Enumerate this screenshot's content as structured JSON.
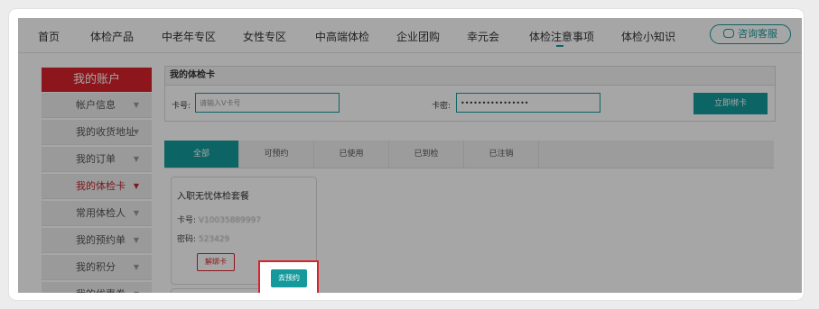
{
  "nav": {
    "items": [
      "首页",
      "体检产品",
      "中老年专区",
      "女性专区",
      "中高端体检",
      "企业团购",
      "幸元会",
      "体检注意事项",
      "体检小知识"
    ],
    "active_index": 7,
    "consult_label": "咨询客服"
  },
  "sidebar": {
    "title": "我的账户",
    "items": [
      "帐户信息",
      "我的收货地址",
      "我的订单",
      "我的体检卡",
      "常用体检人",
      "我的预约单",
      "我的积分",
      "我的优惠券"
    ],
    "active_index": 3
  },
  "card_binding": {
    "title": "我的体检卡",
    "card_label": "卡号:",
    "card_placeholder": "请输入V卡号",
    "password_label": "卡密:",
    "password_value": "••••••••••••••••",
    "bind_button": "立即绑卡"
  },
  "tabs": [
    "全部",
    "可预约",
    "已使用",
    "已到检",
    "已注销"
  ],
  "exam_card": {
    "title": "入职无忧体检套餐",
    "card_no_label": "卡号:",
    "card_no_value": "V10035889997",
    "password_label": "密码:",
    "password_value": "523429",
    "unbind_button": "解绑卡",
    "reserve_button": "去预约"
  },
  "colors": {
    "accent": "#159a9c",
    "brand_red": "#d9222b"
  }
}
